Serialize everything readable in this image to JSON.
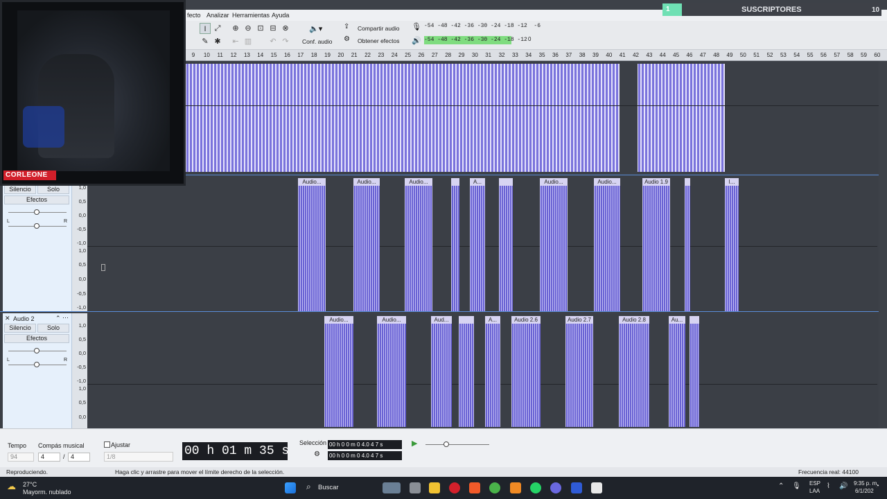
{
  "menu": {
    "items": [
      "fecto",
      "Analizar",
      "Herramientas",
      "Ayuda"
    ]
  },
  "toolbar": {
    "share_audio": "Compartir audio",
    "get_effects": "Obtener efectos",
    "audio_setup": "Conf. audio",
    "rec_meter": "-54 -48 -42 -36 -30 -24 -18 -12  -6",
    "play_meter": "-54 -48 -42 -36 -30 -24 -18 -12",
    "meter_end": "0",
    "meter_r_label": "R"
  },
  "ruler": {
    "ticks": [
      "9",
      "10",
      "11",
      "12",
      "13",
      "14",
      "15",
      "16",
      "17",
      "18",
      "19",
      "20",
      "21",
      "22",
      "23",
      "24",
      "25",
      "26",
      "27",
      "28",
      "29",
      "30",
      "31",
      "32",
      "33",
      "34",
      "35",
      "36",
      "37",
      "38",
      "39",
      "40",
      "41",
      "42",
      "43",
      "44",
      "45",
      "46",
      "47",
      "48",
      "49",
      "50",
      "51",
      "52",
      "53",
      "54",
      "55",
      "56",
      "57",
      "58",
      "59",
      "60"
    ]
  },
  "webcam": {
    "overlay_name": "CORLEONE"
  },
  "subscribers": {
    "count": "1",
    "label": "SUSCRIPTORES",
    "goal": "10"
  },
  "track1": {
    "mute": "Silencio",
    "solo": "Solo",
    "effects": "Efectos",
    "pan_l": "L",
    "pan_r": "R",
    "scale": [
      "1,0",
      "0,5",
      "0,0",
      "-0,5",
      "-1,0",
      "1,0",
      "0,5",
      "0,0",
      "-0,5",
      "-1,0"
    ],
    "clips": [
      "Audio...",
      "Audio...",
      "Audio...",
      "",
      "A...",
      "",
      "Audio...",
      "Audio...",
      "Audio 1.9",
      "",
      "I..."
    ]
  },
  "track2": {
    "name": "Audio 2",
    "mute": "Silencio",
    "solo": "Solo",
    "effects": "Efectos",
    "pan_l": "L",
    "pan_r": "R",
    "scale": [
      "1,0",
      "0,5",
      "0,0",
      "-0,5",
      "-1,0",
      "1,0",
      "0,5",
      "0,0"
    ],
    "clips": [
      "Audio...",
      "Audio...",
      "Aud...",
      "",
      "A...",
      "Audio 2.6",
      "Audio 2.7",
      "Audio 2.8",
      "Au...",
      ""
    ]
  },
  "bottom": {
    "tempo_label": "Tempo",
    "tempo_value": "94",
    "time_sig_label": "Compás musical",
    "time_sig_num": "4",
    "time_sig_sep": "/",
    "time_sig_den": "4",
    "snap_label": "Ajustar",
    "snap_value": "1/8",
    "time_display": "00 h 01 m 35 s",
    "selection_label": "Selección",
    "sel_start": "00 h 0 0 m 0 4.0 4 7 s",
    "sel_end": "00 h 0 0 m 0 4.0 4 7 s"
  },
  "status": {
    "left": "Reproduciendo.",
    "hint": "Haga clic y arrastre para mover el límite derecho de la selección.",
    "rate": "Frecuencia real: 44100"
  },
  "taskbar": {
    "temp": "27°C",
    "weather": "Mayorm. nublado",
    "search": "Buscar",
    "lang": "ESP",
    "region": "LAA",
    "time": "9:35 p. m.",
    "date": "6/1/202"
  }
}
